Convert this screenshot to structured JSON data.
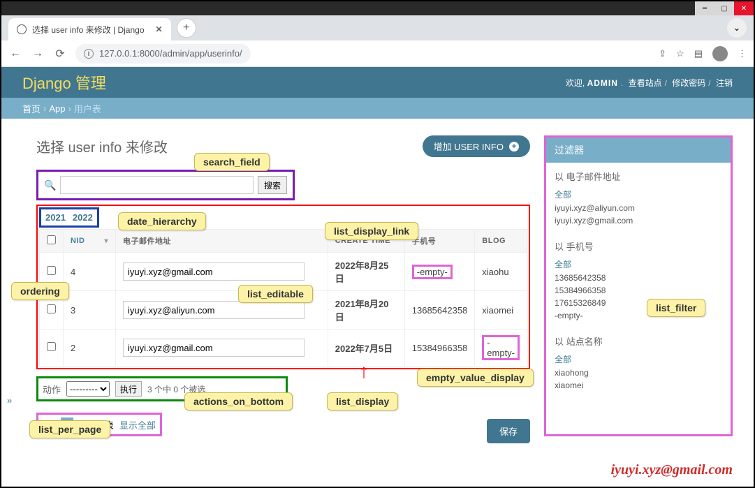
{
  "window": {
    "tab_title": "选择 user info 来修改 | Django",
    "url": "127.0.0.1:8000/admin/app/userinfo/"
  },
  "header": {
    "brand": "Django 管理",
    "welcome": "欢迎,",
    "username": "ADMIN",
    "view_site": "查看站点",
    "change_password": "修改密码",
    "logout": "注销"
  },
  "breadcrumbs": {
    "home": "首页",
    "app": "App",
    "current": "用户表"
  },
  "page": {
    "title": "选择 user info 来修改",
    "add_label": "增加 USER INFO",
    "search_button": "搜索"
  },
  "date_hierarchy": {
    "y1": "2021",
    "y2": "2022"
  },
  "table": {
    "headers": {
      "nid": "NID",
      "email": "电子邮件地址",
      "create_time": "CREATE TIME",
      "phone": "手机号",
      "blog": "BLOG"
    },
    "rows": [
      {
        "nid": "4",
        "email": "iyuyi.xyz@gmail.com",
        "create": "2022年8月25日",
        "phone": "-empty-",
        "blog": "xiaohu"
      },
      {
        "nid": "3",
        "email": "iyuyi.xyz@aliyun.com",
        "create": "2021年8月20日",
        "phone": "13685642358",
        "blog": "xiaomei"
      },
      {
        "nid": "2",
        "email": "iyuyi.xyz@gmail.com",
        "create": "2022年7月5日",
        "phone": "15384966358",
        "blog": "-empty-"
      }
    ]
  },
  "actions": {
    "label": "动作",
    "placeholder": "---------",
    "go": "执行",
    "count": "3 个中 0 个被选"
  },
  "pagination": {
    "p1": "1",
    "p2": "2",
    "total": "4 用户表",
    "show_all": "显示全部"
  },
  "save": "保存",
  "filter": {
    "title": "过滤器",
    "email": {
      "by": "以 电子邮件地址",
      "all": "全部",
      "items": [
        "iyuyi.xyz@aliyun.com",
        "iyuyi.xyz@gmail.com"
      ]
    },
    "phone": {
      "by": "以 手机号",
      "all": "全部",
      "items": [
        "13685642358",
        "15384966358",
        "17615326849",
        "-empty-"
      ]
    },
    "site": {
      "by": "以 站点名称",
      "all": "全部",
      "items": [
        "xiaohong",
        "xiaomei"
      ]
    }
  },
  "callouts": {
    "search_field": "search_field",
    "date_hierarchy": "date_hierarchy",
    "list_display_link": "list_display_link",
    "ordering": "ordering",
    "list_editable": "list_editable",
    "list_filter": "list_filter",
    "empty_value_display": "empty_value_display",
    "actions_on_bottom": "actions_on_bottom",
    "list_display": "list_display",
    "list_per_page": "list_per_page"
  },
  "watermark": "iyuyi.xyz@gmail.com"
}
